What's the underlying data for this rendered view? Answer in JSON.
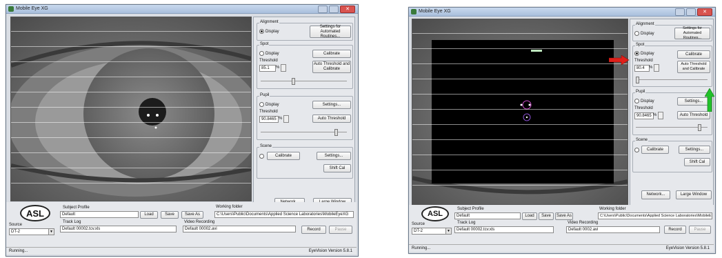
{
  "shared": {
    "window_title": "Mobile Eye XG",
    "subject_profile_label": "Subject Profile",
    "subject_profile_value": "Default",
    "source_label": "Source",
    "track_log_label": "Track Log",
    "working_folder_label": "Working folder",
    "video_recording_label": "Video Recording",
    "load_label": "Load",
    "save_label": "Save",
    "save_as_label": "Save As",
    "record_label": "Record",
    "pause_label": "Pause",
    "network_label": "Network...",
    "large_window_label": "Large Window",
    "status_text": "Running...",
    "alignment_label": "Alignment",
    "display_label": "Display",
    "settings_automated_label": "Settings for Automated Routines...",
    "spot_label": "Spot",
    "calibrate_label": "Calibrate",
    "threshold_label": "Threshold",
    "percent_label": "%",
    "auto_threshold_calibrate_label": "Auto Threshold and Calibrate",
    "pupil_label": "Pupil",
    "settings_label": "Settings...",
    "auto_threshold_label": "Auto Threshold",
    "scene_label": "Scene",
    "shift_cal_label": "Shift Cal",
    "logo_text": "ASL"
  },
  "left": {
    "source_value": "DT-2",
    "track_log_value": "Default 00002.tcv.xls",
    "working_folder_value": "C:\\Users\\Public\\Documents\\Applied Science Laboratories\\MobileEyeXG",
    "video_recording_value": "Default 00002.avi",
    "spot_threshold": "85.1",
    "pupil_threshold": "90.8465",
    "version": "EyeVision   Version 5.8.1"
  },
  "right": {
    "source_value": "DT-2",
    "track_log_value": "Default 00002.tcv.xls",
    "working_folder_value": "C:\\Users\\Public\\Documents\\Applied Science Laboratories\\MobileEyeXG",
    "video_recording_value": "Default 0002.avi",
    "spot_threshold": "80.4",
    "pupil_threshold": "90.8465",
    "version": "EyeVision   Version 5.8.1"
  },
  "colors": {
    "red_arrow": "#e0201a",
    "green_arrow": "#22c12a",
    "window_bg": "#d9dde3"
  }
}
